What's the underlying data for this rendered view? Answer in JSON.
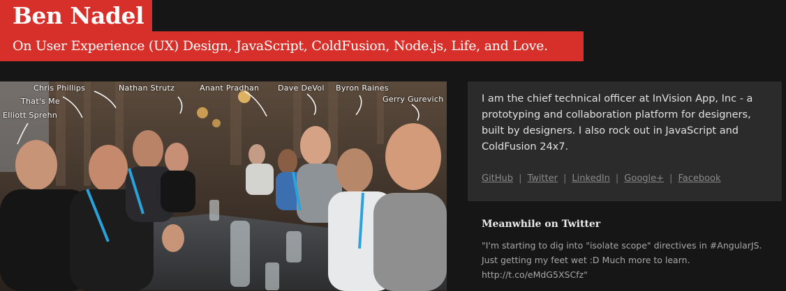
{
  "header": {
    "title": "Ben Nadel",
    "tagline": "On User Experience (UX) Design, JavaScript, ColdFusion, Node.js, Life, and Love."
  },
  "photo": {
    "labels": [
      "Chris Phillips",
      "That's Me",
      "Elliott Sprehn",
      "Nathan Strutz",
      "Anant Pradhan",
      "Dave DeVol",
      "Byron Raines",
      "Gerry Gurevich"
    ]
  },
  "bio": {
    "text": "I am the chief technical officer at InVision App, Inc - a prototyping and collaboration platform for designers, built by designers. I also rock out in JavaScript and ColdFusion 24x7.",
    "links": [
      "GitHub",
      "Twitter",
      "LinkedIn",
      "Google+",
      "Facebook"
    ],
    "separator": "|"
  },
  "twitter": {
    "heading": "Meanwhile on Twitter",
    "tweet_text": "\"I'm starting to dig into \"isolate scope\" directives in #AngularJS. Just getting my feet wet :D Much more to learn.",
    "tweet_link": "http://t.co/eMdG5XSCfz\""
  },
  "colors": {
    "brand_red": "#d72f2a",
    "page_background": "#171617",
    "bio_background": "#2b2b2b"
  }
}
